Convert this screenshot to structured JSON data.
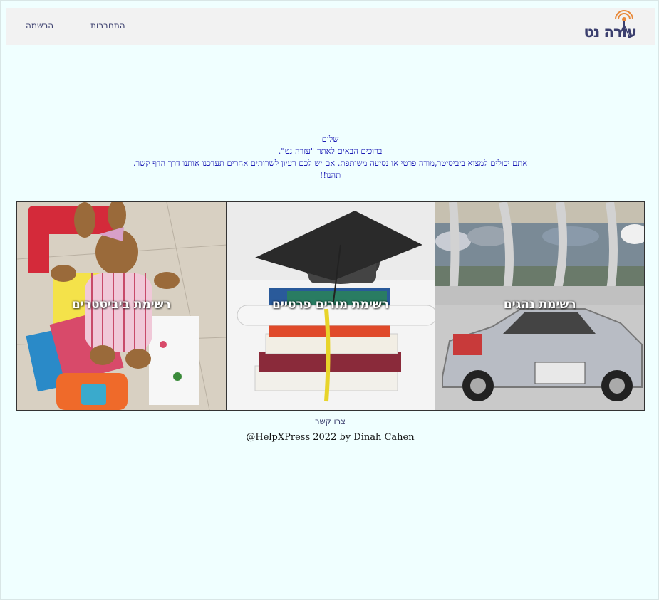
{
  "nav": {
    "logo_text": "עזרה נט",
    "login_label": "התחברות",
    "register_label": "הרשמה"
  },
  "welcome": {
    "line1": "שלום",
    "line2": "ברוכים הבאים לאתר \"עזרה נט\".",
    "line3": "אתם יכולים למצוא ביביסיטר,מורה פרטי או נסיעה משותפת. אם יש לכם רעיון לשרותים אחרים תעדכנו אותנו דרך הדף קשר.",
    "line4": "תהנו!!"
  },
  "tiles": [
    {
      "label": "רשימת ביביסטרים",
      "image": "teddy-bear-with-books-photo"
    },
    {
      "label": "רשימת מורים פרטיים",
      "image": "graduation-cap-on-books-photo"
    },
    {
      "label": "רשימת נהגים",
      "image": "toy-race-car-photo"
    }
  ],
  "contact_label": "צרו קשר",
  "copyright": "@HelpXPress 2022 by Dinah Cahen",
  "colors": {
    "background": "#f0ffff",
    "navbar": "#f2f2f2",
    "nav_text": "#3b3f6e",
    "welcome_text": "#1b1bb5",
    "logo_accent": "#e8893a"
  }
}
